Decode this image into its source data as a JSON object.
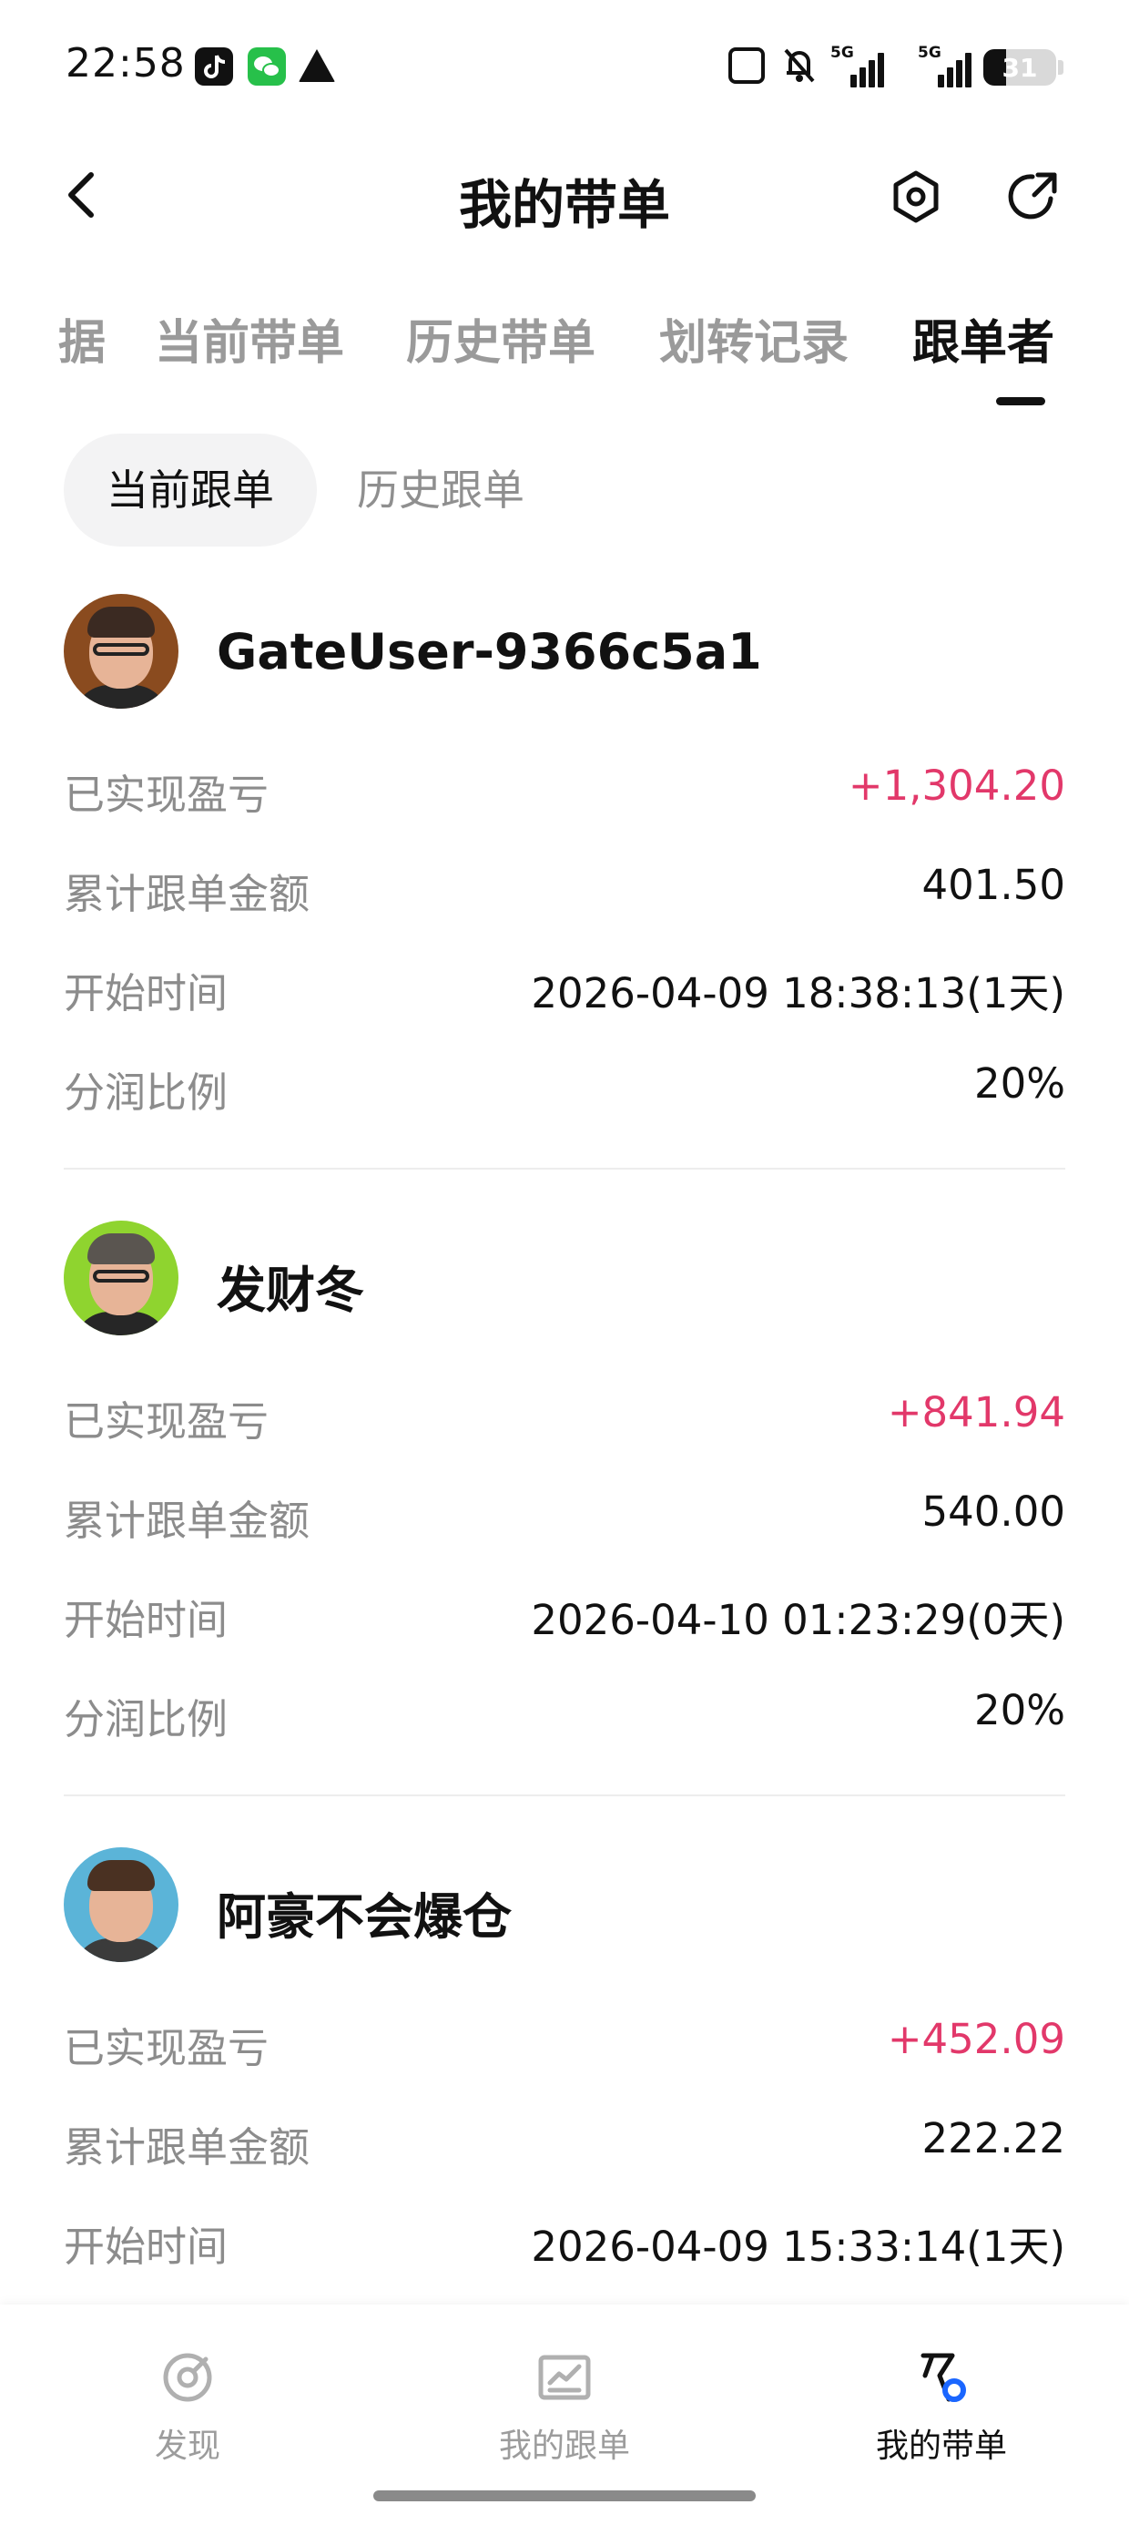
{
  "status_bar": {
    "time": "22:58",
    "apps": [
      "tiktok-icon",
      "wechat-icon",
      "warning-icon"
    ],
    "network": [
      "5G",
      "5G"
    ],
    "battery": "31",
    "battery_level": 0.31
  },
  "header": {
    "title": "我的带单",
    "back_icon": "chevron-left-icon",
    "settings_icon": "hexagon-settings-icon",
    "share_icon": "share-icon"
  },
  "tabs": [
    {
      "label": "据",
      "active": false
    },
    {
      "label": "当前带单",
      "active": false
    },
    {
      "label": "历史带单",
      "active": false
    },
    {
      "label": "划转记录",
      "active": false
    },
    {
      "label": "跟单者",
      "active": true
    }
  ],
  "subtabs": [
    {
      "label": "当前跟单",
      "active": true
    },
    {
      "label": "历史跟单",
      "active": false
    }
  ],
  "followers": [
    {
      "name": "GateUser-9366c5a1",
      "avatar_bg": "#8a4b1f",
      "rows": [
        {
          "label": "已实现盈亏",
          "value": "+1,304.20",
          "positive": true
        },
        {
          "label": "累计跟单金额",
          "value": "401.50",
          "positive": false
        },
        {
          "label": "开始时间",
          "value": "2026-04-09 18:38:13(1天)",
          "positive": false
        },
        {
          "label": "分润比例",
          "value": "20%",
          "positive": false
        }
      ]
    },
    {
      "name": "发财冬",
      "avatar_bg": "#8fd42f",
      "rows": [
        {
          "label": "已实现盈亏",
          "value": "+841.94",
          "positive": true
        },
        {
          "label": "累计跟单金额",
          "value": "540.00",
          "positive": false
        },
        {
          "label": "开始时间",
          "value": "2026-04-10 01:23:29(0天)",
          "positive": false
        },
        {
          "label": "分润比例",
          "value": "20%",
          "positive": false
        }
      ]
    },
    {
      "name": "阿豪不会爆仓",
      "avatar_bg": "#5bb4d8",
      "rows": [
        {
          "label": "已实现盈亏",
          "value": "+452.09",
          "positive": true
        },
        {
          "label": "累计跟单金额",
          "value": "222.22",
          "positive": false
        },
        {
          "label": "开始时间",
          "value": "2026-04-09 15:33:14(1天)",
          "positive": false
        }
      ]
    }
  ],
  "bottom_nav": [
    {
      "label": "发现",
      "icon": "discover-icon",
      "active": false
    },
    {
      "label": "我的跟单",
      "icon": "chart-icon",
      "active": false
    },
    {
      "label": "我的带单",
      "icon": "lead-trade-icon",
      "active": true
    }
  ],
  "colors": {
    "positive": "#e2386a",
    "label": "#8c8c8c",
    "text": "#111111",
    "accent": "#1a66ff"
  }
}
